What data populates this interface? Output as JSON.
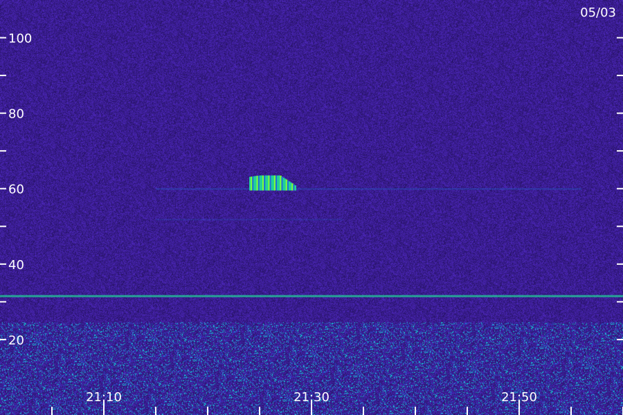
{
  "chart_data": {
    "type": "heatmap",
    "date_label": "05/03",
    "y_tick_labels": [
      "100",
      "80",
      "60",
      "40",
      "20"
    ],
    "y_tick_values": [
      100,
      80,
      60,
      40,
      20
    ],
    "y_minor_ticks": [
      90,
      70,
      50,
      30
    ],
    "ylim": [
      0,
      110
    ],
    "x_tick_labels": [
      "21:10",
      "21:30",
      "21:50"
    ],
    "x_tick_values": [
      1270,
      1290,
      1310
    ],
    "x_minor_ticks": [
      1265,
      1275,
      1280,
      1285,
      1295,
      1300,
      1305,
      1315,
      1320
    ],
    "xlim": [
      1260,
      1320
    ],
    "noise_band_top": 32,
    "features": [
      {
        "kind": "line",
        "y": 31.5,
        "x_start": 1260,
        "x_end": 1320,
        "intensity": 0.75
      },
      {
        "kind": "line",
        "y": 59.9,
        "x_start": 1275,
        "x_end": 1316,
        "intensity": 0.35
      },
      {
        "kind": "line",
        "y": 51.8,
        "x_start": 1275,
        "x_end": 1293,
        "intensity": 0.2
      },
      {
        "kind": "burst",
        "y_low": 59.5,
        "y_high": 63.5,
        "x_start": 1284,
        "x_end": 1288.5,
        "intensity": 0.9
      }
    ],
    "colors": {
      "background": "#2a1566",
      "low": "#3b1fa0",
      "mid": "#1f6fd8",
      "high": "#22d09a",
      "peak": "#7dff3a"
    }
  }
}
